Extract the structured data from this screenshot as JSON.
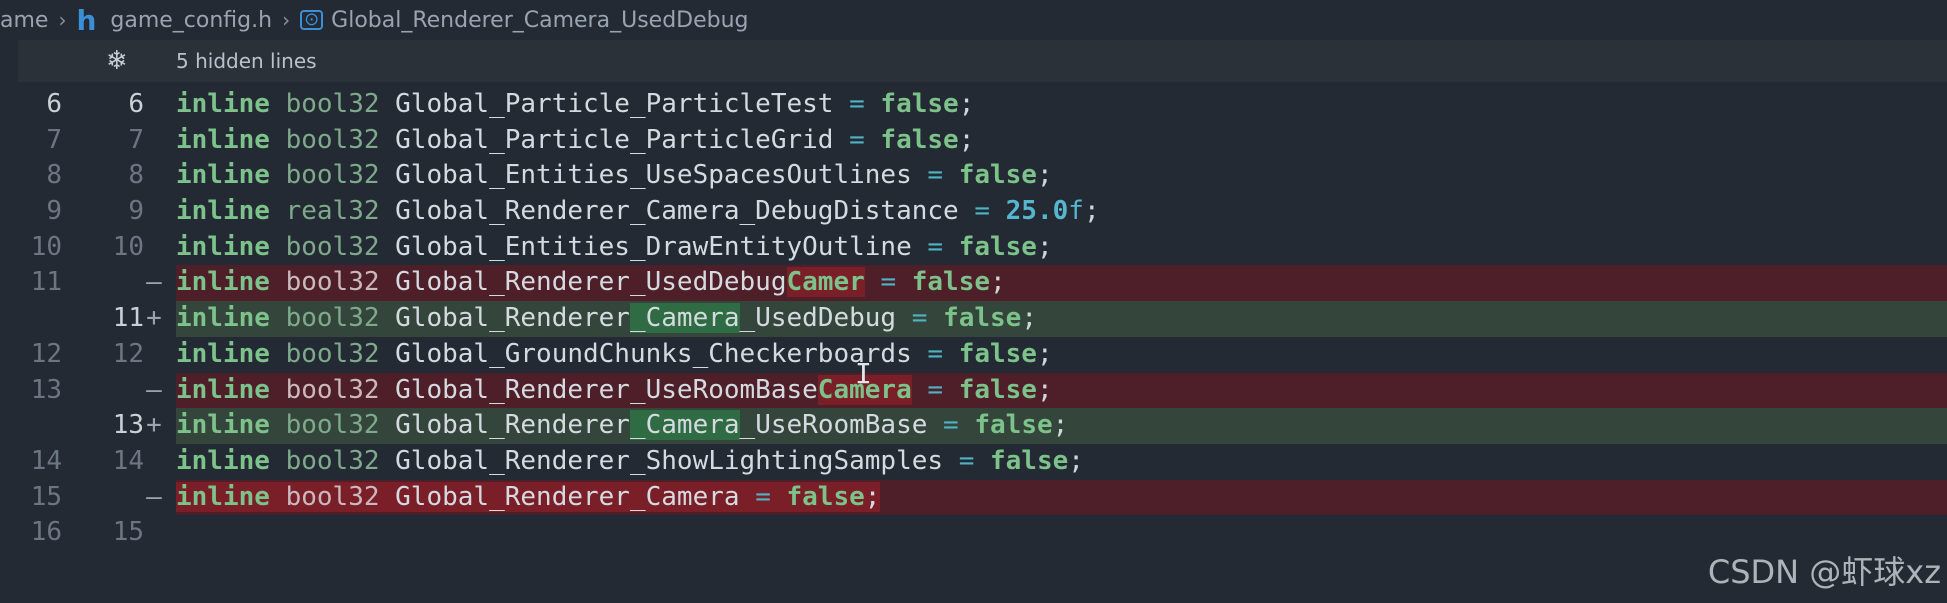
{
  "breadcrumb": {
    "root": "ame",
    "file": "game_config.h",
    "symbol": "Global_Renderer_Camera_UsedDebug"
  },
  "hidden_lines": {
    "label": "5 hidden lines"
  },
  "rows": [
    {
      "orig": "6",
      "mod": "6",
      "sign": "",
      "type": "context",
      "tokens": [
        [
          "kw",
          "inline"
        ],
        [
          "sp",
          " "
        ],
        [
          "ty",
          "bool32"
        ],
        [
          "sp",
          " "
        ],
        [
          "id",
          "Global_Particle_ParticleTest"
        ],
        [
          "sp",
          " "
        ],
        [
          "op",
          "="
        ],
        [
          "sp",
          " "
        ],
        [
          "kw",
          "false"
        ],
        [
          "punc",
          ";"
        ]
      ]
    },
    {
      "orig": "7",
      "mod": "7",
      "sign": "",
      "type": "context",
      "tokens": [
        [
          "kw",
          "inline"
        ],
        [
          "sp",
          " "
        ],
        [
          "ty",
          "bool32"
        ],
        [
          "sp",
          " "
        ],
        [
          "id",
          "Global_Particle_ParticleGrid"
        ],
        [
          "sp",
          " "
        ],
        [
          "op",
          "="
        ],
        [
          "sp",
          " "
        ],
        [
          "kw",
          "false"
        ],
        [
          "punc",
          ";"
        ]
      ]
    },
    {
      "orig": "8",
      "mod": "8",
      "sign": "",
      "type": "context",
      "tokens": [
        [
          "kw",
          "inline"
        ],
        [
          "sp",
          " "
        ],
        [
          "ty",
          "bool32"
        ],
        [
          "sp",
          " "
        ],
        [
          "id",
          "Global_Entities_UseSpacesOutlines"
        ],
        [
          "sp",
          " "
        ],
        [
          "op",
          "="
        ],
        [
          "sp",
          " "
        ],
        [
          "kw",
          "false"
        ],
        [
          "punc",
          ";"
        ]
      ]
    },
    {
      "orig": "9",
      "mod": "9",
      "sign": "",
      "type": "context",
      "tokens": [
        [
          "kw",
          "inline"
        ],
        [
          "sp",
          " "
        ],
        [
          "ty",
          "real32"
        ],
        [
          "sp",
          " "
        ],
        [
          "id",
          "Global_Renderer_Camera_DebugDistance"
        ],
        [
          "sp",
          " "
        ],
        [
          "op",
          "="
        ],
        [
          "sp",
          " "
        ],
        [
          "num",
          "25.0"
        ],
        [
          "f",
          "f"
        ],
        [
          "punc",
          ";"
        ]
      ]
    },
    {
      "orig": "10",
      "mod": "10",
      "sign": "",
      "type": "context",
      "tokens": [
        [
          "kw",
          "inline"
        ],
        [
          "sp",
          " "
        ],
        [
          "ty",
          "bool32"
        ],
        [
          "sp",
          " "
        ],
        [
          "id",
          "Global_Entities_DrawEntityOutline"
        ],
        [
          "sp",
          " "
        ],
        [
          "op",
          "="
        ],
        [
          "sp",
          " "
        ],
        [
          "kw",
          "false"
        ],
        [
          "punc",
          ";"
        ]
      ]
    },
    {
      "orig": "11",
      "mod": "",
      "sign": "—",
      "type": "removed",
      "tokens": [
        [
          "kw",
          "inline"
        ],
        [
          "sp",
          " "
        ],
        [
          "tyr",
          "bool32"
        ],
        [
          "sp",
          " "
        ],
        [
          "id",
          "Global_Renderer_UsedDebug"
        ],
        [
          "hlr",
          "Camer"
        ],
        [
          "sp",
          " "
        ],
        [
          "op",
          "="
        ],
        [
          "sp",
          " "
        ],
        [
          "kw",
          "false"
        ],
        [
          "punc",
          ";"
        ]
      ]
    },
    {
      "orig": "",
      "mod": "11",
      "sign": "+",
      "type": "added",
      "tokens": [
        [
          "kw",
          "inline"
        ],
        [
          "sp",
          " "
        ],
        [
          "ty",
          "bool32"
        ],
        [
          "sp",
          " "
        ],
        [
          "id",
          "Global_Renderer"
        ],
        [
          "hla",
          "_Camera"
        ],
        [
          "id",
          "_UsedDebug"
        ],
        [
          "sp",
          " "
        ],
        [
          "op",
          "="
        ],
        [
          "sp",
          " "
        ],
        [
          "kw",
          "false"
        ],
        [
          "punc",
          ";"
        ]
      ]
    },
    {
      "orig": "12",
      "mod": "12",
      "sign": "",
      "type": "context",
      "tokens": [
        [
          "kw",
          "inline"
        ],
        [
          "sp",
          " "
        ],
        [
          "ty",
          "bool32"
        ],
        [
          "sp",
          " "
        ],
        [
          "id",
          "Global_GroundChunks_Checkerboards"
        ],
        [
          "sp",
          " "
        ],
        [
          "op",
          "="
        ],
        [
          "sp",
          " "
        ],
        [
          "kw",
          "false"
        ],
        [
          "punc",
          ";"
        ]
      ]
    },
    {
      "orig": "13",
      "mod": "",
      "sign": "—",
      "type": "removed",
      "tokens": [
        [
          "kw",
          "inline"
        ],
        [
          "sp",
          " "
        ],
        [
          "tyr",
          "bool32"
        ],
        [
          "sp",
          " "
        ],
        [
          "id",
          "Global_Renderer_UseRoomBase"
        ],
        [
          "hlr",
          "Camera"
        ],
        [
          "sp",
          " "
        ],
        [
          "op",
          "="
        ],
        [
          "sp",
          " "
        ],
        [
          "kw",
          "false"
        ],
        [
          "punc",
          ";"
        ]
      ]
    },
    {
      "orig": "",
      "mod": "13",
      "sign": "+",
      "type": "added",
      "tokens": [
        [
          "kw",
          "inline"
        ],
        [
          "sp",
          " "
        ],
        [
          "ty",
          "bool32"
        ],
        [
          "sp",
          " "
        ],
        [
          "id",
          "Global_Renderer"
        ],
        [
          "hla",
          "_Camera"
        ],
        [
          "id",
          "_UseRoomBase"
        ],
        [
          "sp",
          " "
        ],
        [
          "op",
          "="
        ],
        [
          "sp",
          " "
        ],
        [
          "kw",
          "false"
        ],
        [
          "punc",
          ";"
        ]
      ]
    },
    {
      "orig": "14",
      "mod": "14",
      "sign": "",
      "type": "context",
      "tokens": [
        [
          "kw",
          "inline"
        ],
        [
          "sp",
          " "
        ],
        [
          "ty",
          "bool32"
        ],
        [
          "sp",
          " "
        ],
        [
          "id",
          "Global_Renderer_ShowLightingSamples"
        ],
        [
          "sp",
          " "
        ],
        [
          "op",
          "="
        ],
        [
          "sp",
          " "
        ],
        [
          "kw",
          "false"
        ],
        [
          "punc",
          ";"
        ]
      ]
    },
    {
      "orig": "15",
      "mod": "",
      "sign": "—",
      "type": "removed",
      "tokens": [
        [
          "hlr",
          "inline"
        ],
        [
          "hlr",
          " "
        ],
        [
          "hlrt",
          "bool32"
        ],
        [
          "hlr",
          " "
        ],
        [
          "hlrt",
          "Global_Renderer_Camera"
        ],
        [
          "hlr",
          " "
        ],
        [
          "hlro",
          "="
        ],
        [
          "hlr",
          " "
        ],
        [
          "hlr",
          "false"
        ],
        [
          "hlrt",
          ";"
        ]
      ]
    },
    {
      "orig": "16",
      "mod": "15",
      "sign": "",
      "type": "context",
      "tokens": []
    }
  ],
  "watermark": "CSDN @虾球xz",
  "colors": {
    "editor_bg": "#232a33",
    "removed_line": "#4e1f28",
    "added_line": "#34463b",
    "removed_highlight": "#7a1f28",
    "added_highlight": "#2f6b43",
    "keyword": "#7cc28a",
    "operator": "#4fb3c4",
    "number": "#56b6d0"
  },
  "icons": {
    "file_icon": "h-file-icon",
    "symbol_icon": "symbol-variable-icon",
    "fold_icon": "unfold-icon"
  }
}
